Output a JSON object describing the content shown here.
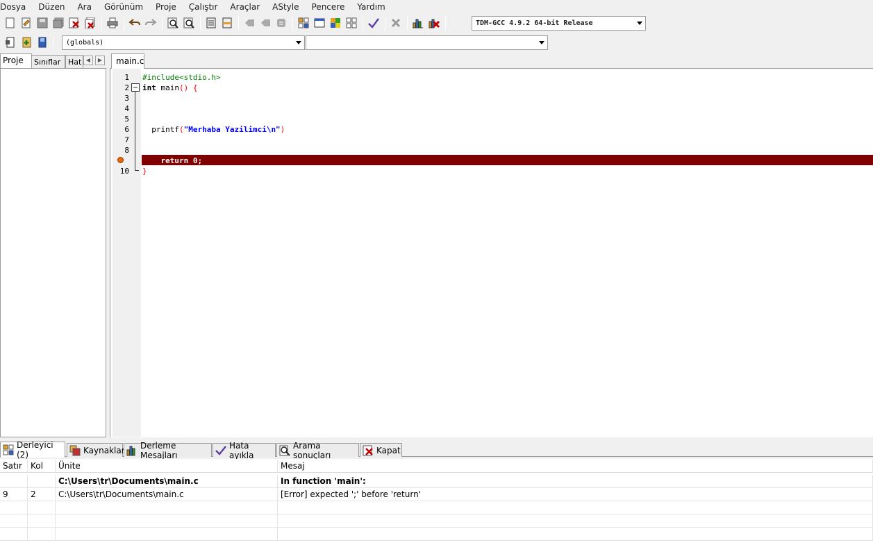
{
  "menu": [
    "Dosya",
    "Düzen",
    "Ara",
    "Görünüm",
    "Proje",
    "Çalıştır",
    "Araçlar",
    "AStyle",
    "Pencere",
    "Yardım"
  ],
  "toolbar": {
    "compiler_select": "TDM-GCC 4.9.2 64-bit Release",
    "scope_select": "(globals)",
    "function_select": ""
  },
  "left_tabs": [
    "Proje",
    "Sınıflar",
    "Hat"
  ],
  "editor_tab": "main.c",
  "code": {
    "line_numbers": [
      "1",
      "2",
      "3",
      "4",
      "5",
      "6",
      "7",
      "8",
      "",
      "10"
    ],
    "lines": [
      {
        "parts": [
          {
            "t": "#include<stdio.h>",
            "c": "#008000"
          }
        ]
      },
      {
        "parts": [
          {
            "t": "int",
            "c": "#000000",
            "b": true
          },
          {
            "t": " main",
            "c": "#000000"
          },
          {
            "t": "() {",
            "c": "#ff0000"
          }
        ]
      },
      {
        "parts": []
      },
      {
        "parts": []
      },
      {
        "parts": []
      },
      {
        "parts": [
          {
            "t": "  printf",
            "c": "#000000"
          },
          {
            "t": "(",
            "c": "#ff0000"
          },
          {
            "t": "\"Merhaba Yazilimci\\n\"",
            "c": "#0000ff",
            "b": true
          },
          {
            "t": ")",
            "c": "#ff0000"
          }
        ]
      },
      {
        "parts": []
      },
      {
        "parts": []
      },
      {
        "parts": [
          {
            "t": "    return 0;",
            "c": "#ffffff",
            "b": true
          }
        ]
      },
      {
        "parts": [
          {
            "t": "}",
            "c": "#ff0000"
          }
        ]
      }
    ]
  },
  "bottom_tabs": [
    {
      "label": "Derleyici (2)",
      "icon": "compiler-grid-icon",
      "active": true
    },
    {
      "label": "Kaynaklar",
      "icon": "resources-icon",
      "active": false
    },
    {
      "label": "Derleme Mesajları",
      "icon": "compile-log-chart-icon",
      "active": false
    },
    {
      "label": "Hata ayıkla",
      "icon": "debug-check-icon",
      "active": false
    },
    {
      "label": "Arama sonuçları",
      "icon": "search-results-icon",
      "active": false
    },
    {
      "label": "Kapat",
      "icon": "close-panel-icon",
      "active": false
    }
  ],
  "messages": {
    "columns": [
      "Satır",
      "Kol",
      "Ünite",
      "Mesaj"
    ],
    "rows": [
      {
        "line": "",
        "col": "",
        "unit": "C:\\Users\\tr\\Documents\\main.c",
        "msg": "In function 'main':",
        "bold": true
      },
      {
        "line": "9",
        "col": "2",
        "unit": "C:\\Users\\tr\\Documents\\main.c",
        "msg": "[Error] expected ';' before 'return'",
        "bold": false
      }
    ]
  },
  "colors": {
    "error_line": "#800000",
    "keyword_green": "#008000",
    "string_blue": "#0000ff",
    "brace_red": "#ff0000"
  }
}
